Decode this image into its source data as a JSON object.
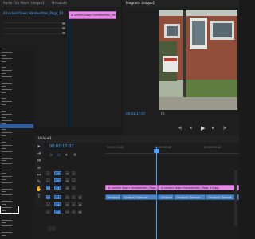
{
  "source_panel": {
    "tabs": [
      "Audio Clip Mixer: Unique1",
      "Metadata"
    ],
    "clip_name": "A Locked Down Handwritten_Page_10.jpg"
  },
  "effects_panel": {
    "items": [
      "a",
      "b",
      "c",
      "d",
      "e",
      "f",
      "g",
      "h",
      "i",
      "j",
      "k",
      "l",
      "m",
      "n",
      "o",
      "p",
      "q",
      "r",
      "s",
      "t",
      "u",
      "v",
      "w",
      "x",
      "y",
      "z",
      "aa",
      "bb",
      "cc",
      "dd",
      "ee",
      "ff",
      "gg",
      "hh",
      "ii",
      "jj",
      "kk",
      "ll",
      "mm",
      "nn",
      "oo",
      "pp",
      "qq",
      "rr",
      "ss",
      "tt",
      "uu",
      "vv",
      "ww",
      "xx",
      "yy",
      "zz",
      "ab",
      "ac",
      "ad",
      "ae",
      "af",
      "ag",
      "ah",
      "ai",
      "aj"
    ]
  },
  "program_monitor": {
    "tab": "Program: Unique1",
    "timecode": "00:01:17:07",
    "fit_label": "Fit"
  },
  "timeline": {
    "tab": "Unique1",
    "timecode": "00:01:17:07",
    "ruler_ticks": [
      "00:01:15:00",
      "00:01:20:00",
      "00:01:25:00"
    ],
    "video_clips": [
      {
        "label": "A Locked Down Handwritten_Page_10.jpg"
      },
      {
        "label": "A Locked Down Handwritten_Page_10.jpg"
      }
    ],
    "audio_clips": [
      {
        "label": "Unique1 Sample"
      },
      {
        "label": "Unique1 Sample"
      },
      {
        "label": "Unique1 Sample"
      },
      {
        "label": "Unique1 Sample"
      },
      {
        "label": "Unique1 Sample"
      }
    ],
    "tracks": [
      "V3",
      "V2",
      "V1",
      "A1",
      "A2",
      "A3"
    ]
  },
  "colors": {
    "accent_blue": "#4aa3ff",
    "video_clip": "#e48ce6",
    "audio_clip": "#4a86c8",
    "playhead": "#4aa3ff"
  }
}
